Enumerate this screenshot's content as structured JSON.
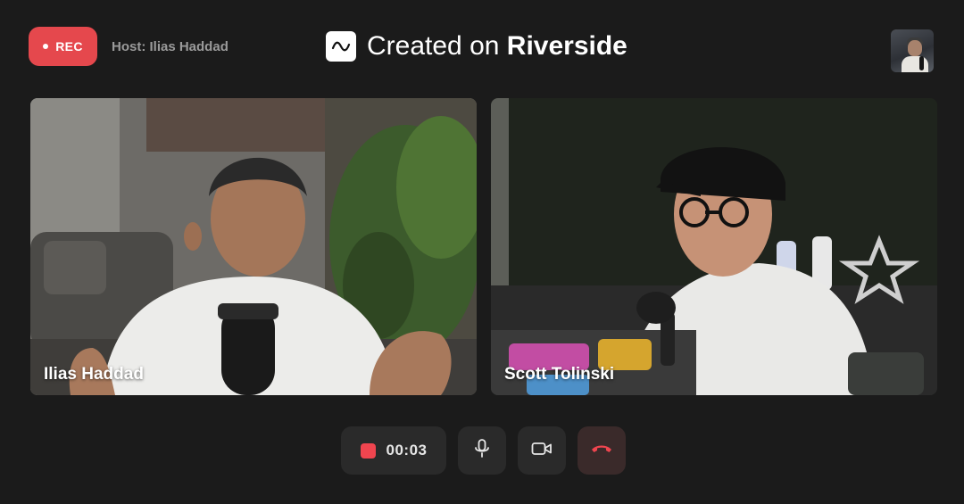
{
  "recording": {
    "badge_label": "REC",
    "host_label": "Host: Ilias Haddad"
  },
  "brand": {
    "prefix": "Created on",
    "name": "Riverside",
    "logo_icon": "waveform-icon"
  },
  "self_view": {
    "icon": "self-preview-thumbnail"
  },
  "participants": [
    {
      "name": "Ilias Haddad"
    },
    {
      "name": "Scott Tolinski"
    }
  ],
  "controls": {
    "timer": "00:03",
    "stop_icon": "stop-icon",
    "mic_icon": "microphone-icon",
    "camera_icon": "camera-icon",
    "leave_icon": "hang-up-icon"
  },
  "colors": {
    "background": "#1b1b1b",
    "rec_red": "#e5484d",
    "control_bg": "#2a2a2a",
    "hangup_red": "#e5484d"
  }
}
